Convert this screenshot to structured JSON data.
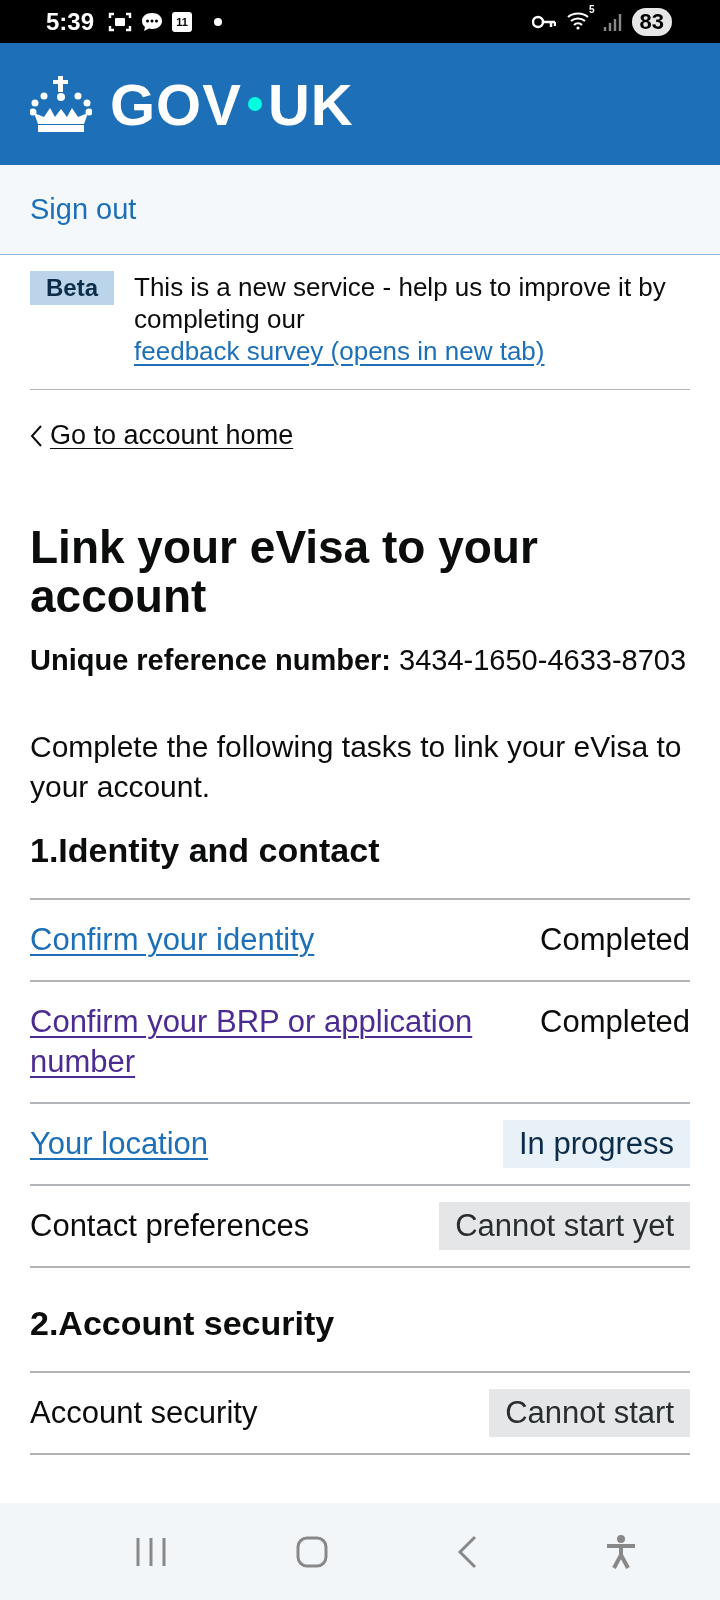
{
  "status_bar": {
    "time": "5:39",
    "calendar_day": "11",
    "wifi_label": "5",
    "battery": "83"
  },
  "header": {
    "logo_parts": [
      "GOV",
      "UK"
    ]
  },
  "account_bar": {
    "sign_out": "Sign out"
  },
  "phase_banner": {
    "tag": "Beta",
    "text": "This is a new service - help us to improve it by completing our",
    "link": "feedback survey (opens in new tab)"
  },
  "back_link": "Go to account home",
  "heading": "Link your eVisa to your account",
  "reference": "**Unique reference number:** 3434-1650-4633-8703",
  "intro": "Complete the following tasks to link your eVisa to your account.",
  "sections": [
    {
      "title": "1.Identity and contact",
      "tasks": [
        {
          "label": "Confirm your identity",
          "kind": "link",
          "visited": false,
          "status": {
            "text": "Completed",
            "kind": "plain"
          }
        },
        {
          "label": "Confirm your BRP or application number",
          "kind": "link",
          "visited": true,
          "status": {
            "text": "Completed",
            "kind": "plain"
          }
        },
        {
          "label": "Your location",
          "kind": "link",
          "visited": false,
          "status": {
            "text": "In progress",
            "kind": "blue"
          }
        },
        {
          "label": "Contact preferences",
          "kind": "text",
          "status": {
            "text": "Cannot start yet",
            "kind": "grey"
          }
        }
      ]
    },
    {
      "title": "2.Account security",
      "tasks": [
        {
          "label": "Account security",
          "kind": "text",
          "status": {
            "text": "Cannot start",
            "kind": "grey"
          }
        }
      ]
    }
  ]
}
